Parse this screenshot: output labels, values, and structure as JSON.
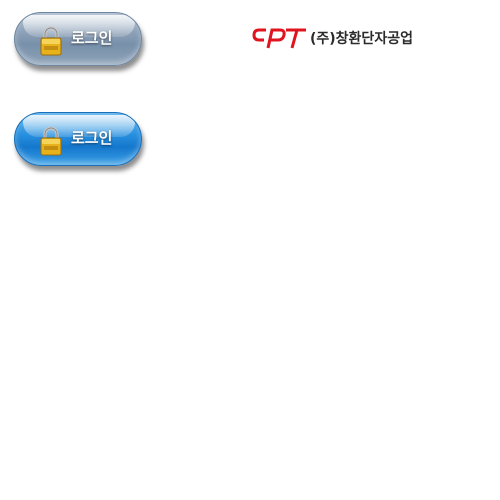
{
  "buttons": [
    {
      "label": "로그인",
      "state": "default",
      "color": "#8fa3b9"
    },
    {
      "label": "로그인",
      "state": "hover",
      "color": "#2a92e0"
    }
  ],
  "logo": {
    "mark_text": "CPT",
    "company_name": "(주)창환단자공업",
    "mark_color": "#e0141e"
  },
  "icons": {
    "button_icon": "padlock-icon"
  }
}
